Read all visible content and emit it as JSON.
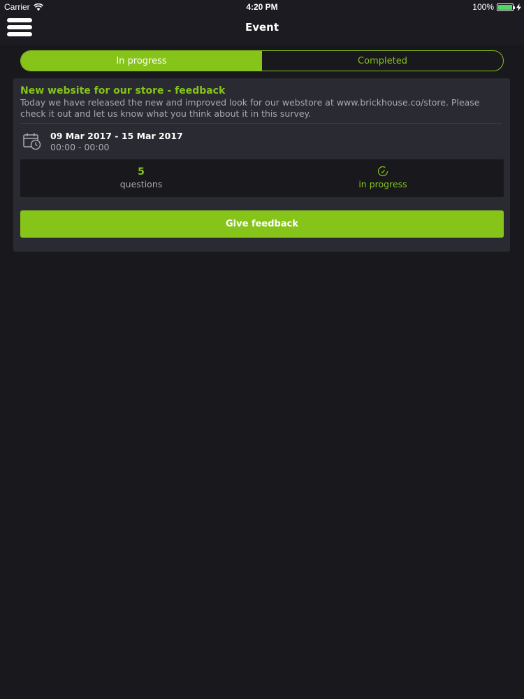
{
  "status_bar": {
    "carrier": "Carrier",
    "time": "4:20 PM",
    "battery": "100%"
  },
  "nav": {
    "title": "Event",
    "menu_icon": "hamburger-menu-icon"
  },
  "tabs": [
    {
      "label": "In progress",
      "active": true
    },
    {
      "label": "Completed",
      "active": false
    }
  ],
  "card": {
    "title": "New website for our store - feedback",
    "description": "Today we have released the new and improved look for our webstore at www.brickhouse.co/store. Please check it out and let us know what you think about it in this survey.",
    "date_range": "09 Mar 2017 - 15 Mar 2017",
    "time_range": "00:00 - 00:00",
    "stats": {
      "questions_count": "5",
      "questions_label": "questions",
      "status_label": "in progress"
    },
    "button_label": "Give feedback"
  },
  "colors": {
    "accent": "#86c41a",
    "background": "#18181d",
    "card": "#2a2a33",
    "muted_text": "#a9a9b4"
  }
}
